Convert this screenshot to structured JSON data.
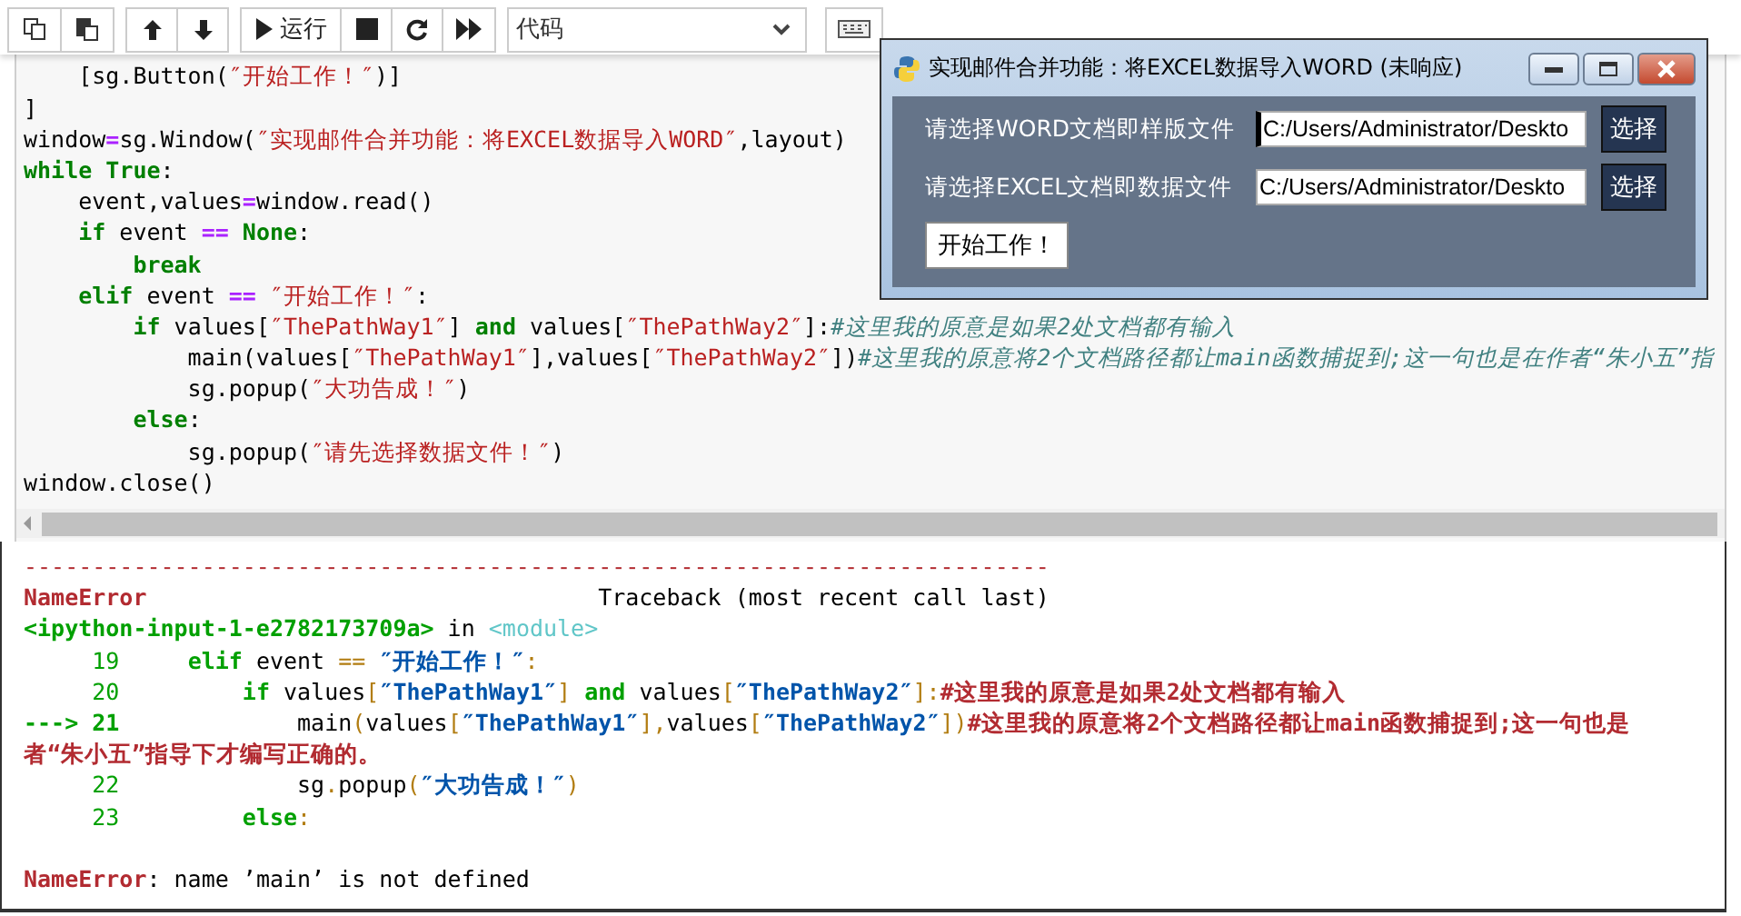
{
  "toolbar": {
    "groups": [
      {
        "buttons": [
          {
            "kind": "copy"
          },
          {
            "kind": "paste"
          }
        ]
      },
      {
        "buttons": [
          {
            "kind": "up"
          },
          {
            "kind": "down"
          }
        ]
      },
      {
        "buttons": [
          {
            "kind": "run",
            "label": "运行"
          },
          {
            "kind": "stop"
          },
          {
            "kind": "restart"
          },
          {
            "kind": "fastforward"
          }
        ]
      }
    ],
    "cell_type": {
      "value": "代码"
    },
    "keyboard": {
      "kind": "keyboard"
    }
  },
  "code_cell": {
    "lines": [
      [
        {
          "kind": "plain",
          "text": "    [sg.Button("
        },
        {
          "kind": "str",
          "text": "″开始工作！″"
        },
        {
          "kind": "plain",
          "text": ")]"
        }
      ],
      [
        {
          "kind": "plain",
          "text": "]"
        }
      ],
      [
        {
          "kind": "plain",
          "text": "window"
        },
        {
          "kind": "op",
          "text": "="
        },
        {
          "kind": "plain",
          "text": "sg.Window("
        },
        {
          "kind": "str",
          "text": "″实现邮件合并功能：将EXCEL数据导入WORD″"
        },
        {
          "kind": "plain",
          "text": ",layout)"
        }
      ],
      [
        {
          "kind": "kw",
          "text": "while"
        },
        {
          "kind": "kw",
          "text": " True"
        },
        {
          "kind": "plain",
          "text": ":"
        }
      ],
      [
        {
          "kind": "plain",
          "text": "    event,values"
        },
        {
          "kind": "op",
          "text": "="
        },
        {
          "kind": "plain",
          "text": "window.read()"
        }
      ],
      [
        {
          "kind": "kw",
          "text": "    if"
        },
        {
          "kind": "plain",
          "text": " event "
        },
        {
          "kind": "op",
          "text": "=="
        },
        {
          "kind": "kw",
          "text": " None"
        },
        {
          "kind": "plain",
          "text": ":"
        }
      ],
      [
        {
          "kind": "kw",
          "text": "        break"
        }
      ],
      [
        {
          "kind": "kw",
          "text": "    elif"
        },
        {
          "kind": "plain",
          "text": " event "
        },
        {
          "kind": "op",
          "text": "=="
        },
        {
          "kind": "str",
          "text": " ″开始工作！″"
        },
        {
          "kind": "plain",
          "text": ":"
        }
      ],
      [
        {
          "kind": "kw",
          "text": "        if"
        },
        {
          "kind": "plain",
          "text": " values["
        },
        {
          "kind": "str",
          "text": "″ThePathWay1″"
        },
        {
          "kind": "plain",
          "text": "] "
        },
        {
          "kind": "kw",
          "text": "and"
        },
        {
          "kind": "plain",
          "text": " values["
        },
        {
          "kind": "str",
          "text": "″ThePathWay2″"
        },
        {
          "kind": "plain",
          "text": "]:"
        },
        {
          "kind": "comment",
          "text": "#这里我的原意是如果2处文档都有输入"
        }
      ],
      [
        {
          "kind": "plain",
          "text": "            main(values["
        },
        {
          "kind": "str",
          "text": "″ThePathWay1″"
        },
        {
          "kind": "plain",
          "text": "],values["
        },
        {
          "kind": "str",
          "text": "″ThePathWay2″"
        },
        {
          "kind": "plain",
          "text": "])"
        },
        {
          "kind": "comment",
          "text": "#这里我的原意将2个文档路径都让main函数捕捉到;这一句也是在作者“朱小五”指"
        }
      ],
      [
        {
          "kind": "plain",
          "text": "            sg.popup("
        },
        {
          "kind": "str",
          "text": "″大功告成！″"
        },
        {
          "kind": "plain",
          "text": ")"
        }
      ],
      [
        {
          "kind": "kw",
          "text": "        else"
        },
        {
          "kind": "plain",
          "text": ":"
        }
      ],
      [
        {
          "kind": "plain",
          "text": "            sg.popup("
        },
        {
          "kind": "str",
          "text": "″请先选择数据文件！″"
        },
        {
          "kind": "plain",
          "text": ")"
        }
      ],
      [
        {
          "kind": "plain",
          "text": "window.close()"
        }
      ]
    ]
  },
  "dialog": {
    "title": "实现邮件合并功能：将EXCEL数据导入WORD (未响应)",
    "rows": [
      {
        "label": "请选择WORD文档即样版文件",
        "value": "C:/Users/Administrator/Deskto",
        "focused": true,
        "button": "选择"
      },
      {
        "label": "请选择EXCEL文档即数据文件",
        "value": "C:/Users/Administrator/Deskto",
        "focused": false,
        "button": "选择"
      }
    ],
    "start_button": "开始工作！"
  },
  "output": {
    "lines": [
      [
        {
          "kind": "rule",
          "text": "---------------------------------------------------------------------------"
        }
      ],
      [
        {
          "kind": "err",
          "text": "NameError"
        },
        {
          "kind": "plain",
          "text": "                                 Traceback (most recent call last)"
        }
      ],
      [
        {
          "kind": "file",
          "text": "<ipython-input-1-e2782173709a>"
        },
        {
          "kind": "plain",
          "text": " in "
        },
        {
          "kind": "module",
          "text": "<module>"
        }
      ],
      [
        {
          "kind": "lineno",
          "text": "     19"
        },
        {
          "kind": "kw",
          "text": "     elif"
        },
        {
          "kind": "plain",
          "text": " event "
        },
        {
          "kind": "punct",
          "text": "=="
        },
        {
          "kind": "str",
          "text": " ″开始工作！″"
        },
        {
          "kind": "punct",
          "text": ":"
        }
      ],
      [
        {
          "kind": "lineno",
          "text": "     20"
        },
        {
          "kind": "kw",
          "text": "         if"
        },
        {
          "kind": "plain",
          "text": " values"
        },
        {
          "kind": "punct",
          "text": "["
        },
        {
          "kind": "str",
          "text": "″ThePathWay1″"
        },
        {
          "kind": "punct",
          "text": "]"
        },
        {
          "kind": "kw",
          "text": " and"
        },
        {
          "kind": "plain",
          "text": " values"
        },
        {
          "kind": "punct",
          "text": "["
        },
        {
          "kind": "str",
          "text": "″ThePathWay2″"
        },
        {
          "kind": "punct",
          "text": "]:"
        },
        {
          "kind": "err",
          "text": "#这里我的原意是如果2处文档都有输入"
        }
      ],
      [
        {
          "kind": "arrow",
          "text": "---> 21"
        },
        {
          "kind": "plain",
          "text": "             main"
        },
        {
          "kind": "punct",
          "text": "("
        },
        {
          "kind": "plain",
          "text": "values"
        },
        {
          "kind": "punct",
          "text": "["
        },
        {
          "kind": "str",
          "text": "″ThePathWay1″"
        },
        {
          "kind": "punct",
          "text": "],"
        },
        {
          "kind": "plain",
          "text": "values"
        },
        {
          "kind": "punct",
          "text": "["
        },
        {
          "kind": "str",
          "text": "″ThePathWay2″"
        },
        {
          "kind": "punct",
          "text": "])"
        },
        {
          "kind": "err",
          "text": "#这里我的原意将2个文档路径都让main函数捕捉到;这一句也是"
        }
      ],
      [
        {
          "kind": "err",
          "text": "者“朱小五”指导下才编写正确的。"
        }
      ],
      [
        {
          "kind": "lineno",
          "text": "     22"
        },
        {
          "kind": "plain",
          "text": "             sg"
        },
        {
          "kind": "punct",
          "text": "."
        },
        {
          "kind": "plain",
          "text": "popup"
        },
        {
          "kind": "punct",
          "text": "("
        },
        {
          "kind": "str",
          "text": "″大功告成！″"
        },
        {
          "kind": "punct",
          "text": ")"
        }
      ],
      [
        {
          "kind": "lineno",
          "text": "     23"
        },
        {
          "kind": "kw",
          "text": "         else"
        },
        {
          "kind": "punct",
          "text": ":"
        }
      ],
      [
        {
          "kind": "err",
          "text": "NameError",
          "spaced": true
        },
        {
          "kind": "plain",
          "text": ": name ’main’ is not defined"
        }
      ]
    ]
  }
}
